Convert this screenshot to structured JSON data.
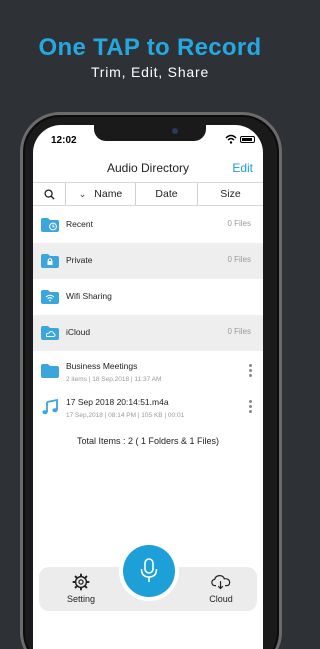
{
  "promo": {
    "title": "One TAP to Record",
    "subtitle": "Trim, Edit, Share"
  },
  "status": {
    "time": "12:02"
  },
  "nav": {
    "title": "Audio Directory",
    "edit_label": "Edit"
  },
  "sortbar": {
    "name_label": "Name",
    "date_label": "Date",
    "size_label": "Size"
  },
  "items": [
    {
      "label": "Recent",
      "count": "0 Files",
      "icon": "clock-folder-icon"
    },
    {
      "label": "Private",
      "count": "0 Files",
      "icon": "lock-folder-icon"
    },
    {
      "label": "Wifi Sharing",
      "icon": "wifi-folder-icon"
    },
    {
      "label": "iCloud",
      "count": "0 Files",
      "icon": "cloud-folder-icon"
    },
    {
      "label": "Business Meetings",
      "sub": "2 items | 18 Sep,2018 | 11:37 AM",
      "icon": "folder-icon"
    },
    {
      "label": "17 Sep 2018 20:14:51.m4a",
      "sub": "17 Sep,2018 | 08:14 PM | 105 KB | 00:01",
      "icon": "music-note-icon"
    }
  ],
  "footer": {
    "total": "Total Items : 2 ( 1 Folders & 1 Files)"
  },
  "tabbar": {
    "setting_label": "Setting",
    "cloud_label": "Cloud"
  },
  "colors": {
    "accent": "#1d9fd8",
    "background": "#2e3236"
  }
}
